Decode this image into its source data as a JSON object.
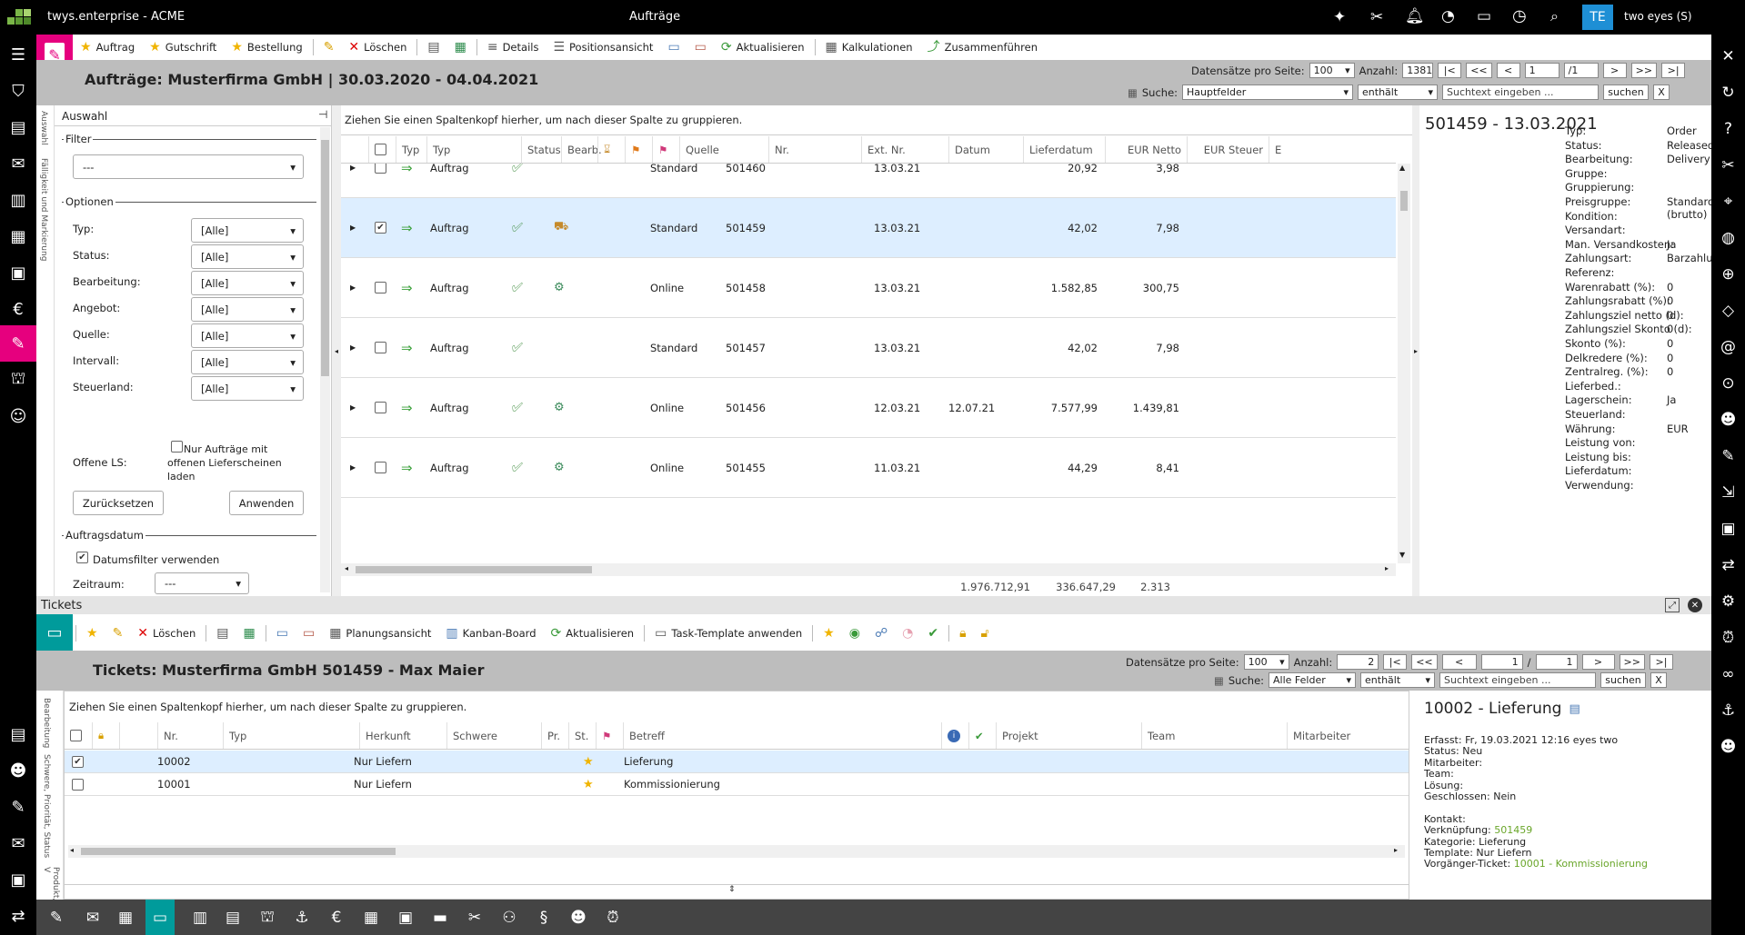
{
  "app": {
    "title": "twys.enterprise - ACME",
    "window_title": "Aufträge",
    "user_initials": "TE",
    "user_name": "two eyes (S)"
  },
  "orders": {
    "toolbar": {
      "auftrag": "Auftrag",
      "gutschrift": "Gutschrift",
      "bestellung": "Bestellung",
      "loeschen": "Löschen",
      "details": "Details",
      "positionsansicht": "Positionsansicht",
      "aktualisieren": "Aktualisieren",
      "kalkulationen": "Kalkulationen",
      "zusammenfuehren": "Zusammenführen"
    },
    "title": "Aufträge: Musterfirma GmbH | 30.03.2020 - 04.04.2021",
    "pager": {
      "label": "Datensätze pro Seite:",
      "per_page": "100",
      "count_label": "Anzahl:",
      "count": "1381",
      "first": "|<",
      "prev2": "<<",
      "prev": "<",
      "page": "1",
      "of": "/1",
      "next": ">",
      "next2": ">>",
      "last": ">|"
    },
    "search": {
      "label": "Suche:",
      "field": "Hauptfelder",
      "op": "enthält",
      "placeholder": "Suchtext eingeben ...",
      "button": "suchen",
      "clear": "X"
    },
    "filter_panel": {
      "header": "Auswahl",
      "pin": "⊣",
      "side_tabs": [
        "Auswahl",
        "Fälligkeit und Markierung"
      ],
      "filter_legend": "Filter",
      "filter_value": "---",
      "options_legend": "Optionen",
      "options": [
        {
          "label": "Typ:",
          "value": "[Alle]"
        },
        {
          "label": "Status:",
          "value": "[Alle]"
        },
        {
          "label": "Bearbeitung:",
          "value": "[Alle]"
        },
        {
          "label": "Angebot:",
          "value": "[Alle]"
        },
        {
          "label": "Quelle:",
          "value": "[Alle]"
        },
        {
          "label": "Intervall:",
          "value": "[Alle]"
        },
        {
          "label": "Steuerland:",
          "value": "[Alle]"
        }
      ],
      "offene_ls_label": "Offene LS:",
      "offene_ls_text": "Nur Aufträge mit offenen Lieferscheinen laden",
      "reset": "Zurücksetzen",
      "apply": "Anwenden",
      "date_legend": "Auftragsdatum",
      "date_filter": "Datumsfilter verwenden",
      "zeitraum_label": "Zeitraum:",
      "zeitraum_value": "---"
    },
    "group_hint": "Ziehen Sie einen Spaltenkopf hierher, um nach dieser Spalte zu gruppieren.",
    "columns": [
      "Typ",
      "Typ",
      "Status",
      "Bearb.",
      "Quelle",
      "Nr.",
      "Ext. Nr.",
      "Datum",
      "Lieferdatum",
      "EUR Netto",
      "EUR Steuer",
      "E"
    ],
    "rows": [
      {
        "type": "Auftrag",
        "source": "Standard",
        "nr": "501460",
        "date": "13.03.21",
        "delivery": "",
        "net": "20,92",
        "tax": "3,98",
        "checked": false,
        "bearb": ""
      },
      {
        "type": "Auftrag",
        "source": "Standard",
        "nr": "501459",
        "date": "13.03.21",
        "delivery": "",
        "net": "42,02",
        "tax": "7,98",
        "checked": true,
        "bearb": "truck"
      },
      {
        "type": "Auftrag",
        "source": "Online",
        "nr": "501458",
        "date": "13.03.21",
        "delivery": "",
        "net": "1.582,85",
        "tax": "300,75",
        "checked": false,
        "bearb": "gear"
      },
      {
        "type": "Auftrag",
        "source": "Standard",
        "nr": "501457",
        "date": "13.03.21",
        "delivery": "",
        "net": "42,02",
        "tax": "7,98",
        "checked": false,
        "bearb": ""
      },
      {
        "type": "Auftrag",
        "source": "Online",
        "nr": "501456",
        "date": "12.03.21",
        "delivery": "12.07.21",
        "net": "7.577,99",
        "tax": "1.439,81",
        "checked": false,
        "bearb": "gear"
      },
      {
        "type": "Auftrag",
        "source": "Online",
        "nr": "501455",
        "date": "11.03.21",
        "delivery": "",
        "net": "44,29",
        "tax": "8,41",
        "checked": false,
        "bearb": "gear"
      }
    ],
    "totals": {
      "net": "1.976.712,91",
      "tax": "336.647,29",
      "other": "2.313"
    },
    "detail": {
      "title": "501459 - 13.03.2021",
      "fields": [
        {
          "label": "Typ:",
          "value": "Order"
        },
        {
          "label": "Status:",
          "value": "Released"
        },
        {
          "label": "Bearbeitung:",
          "value": "Delivery"
        },
        {
          "label": "Gruppe:",
          "value": ""
        },
        {
          "label": "Gruppierung:",
          "value": ""
        },
        {
          "label": "Preisgruppe:",
          "value": "Standard (brutto)"
        },
        {
          "label": "Kondition:",
          "value": ""
        },
        {
          "label": "Versandart:",
          "value": ""
        },
        {
          "label": "Man. Versandkosten:",
          "value": "Ja"
        },
        {
          "label": "Zahlungsart:",
          "value": "Barzahlung"
        },
        {
          "label": "Referenz:",
          "value": ""
        },
        {
          "label": "Warenrabatt (%):",
          "value": "0"
        },
        {
          "label": "Zahlungsrabatt (%):",
          "value": "0"
        },
        {
          "label": "Zahlungsziel netto (d):",
          "value": "0"
        },
        {
          "label": "Zahlungsziel Skonto (d):",
          "value": "0"
        },
        {
          "label": "Skonto (%):",
          "value": "0"
        },
        {
          "label": "Delkredere (%):",
          "value": "0"
        },
        {
          "label": "Zentralreg. (%):",
          "value": "0"
        },
        {
          "label": "Lieferbed.:",
          "value": ""
        },
        {
          "label": "Lagerschein:",
          "value": "Ja"
        },
        {
          "label": "Steuerland:",
          "value": ""
        },
        {
          "label": "Währung:",
          "value": "EUR"
        },
        {
          "label": "Leistung von:",
          "value": ""
        },
        {
          "label": "Leistung bis:",
          "value": ""
        },
        {
          "label": "Lieferdatum:",
          "value": ""
        },
        {
          "label": "Verwendung:",
          "value": ""
        }
      ]
    }
  },
  "tickets": {
    "header": "Tickets",
    "toolbar": {
      "loeschen": "Löschen",
      "planungsansicht": "Planungsansicht",
      "kanban": "Kanban-Board",
      "aktualisieren": "Aktualisieren",
      "task_template": "Task-Template anwenden"
    },
    "title": "Tickets: Musterfirma GmbH 501459 - Max Maier",
    "pager": {
      "label": "Datensätze pro Seite:",
      "per_page": "100",
      "count_label": "Anzahl:",
      "count": "2",
      "first": "|<",
      "prev2": "<<",
      "prev": "<",
      "page": "1",
      "of": "/",
      "total": "1",
      "next": ">",
      "next2": ">>",
      "last": ">|"
    },
    "search": {
      "label": "Suche:",
      "field": "Alle Felder",
      "op": "enthält",
      "placeholder": "Suchtext eingeben ...",
      "button": "suchen",
      "clear": "X"
    },
    "side_tabs": [
      "Bearbeitung",
      "Schwere, Priorität, Status",
      "Produkt, V"
    ],
    "group_hint": "Ziehen Sie einen Spaltenkopf hierher, um nach dieser Spalte zu gruppieren.",
    "columns": [
      "Nr.",
      "Typ",
      "Herkunft",
      "Schwere",
      "Pr.",
      "St.",
      "Betreff",
      "Projekt",
      "Team",
      "Mitarbeiter"
    ],
    "rows": [
      {
        "nr": "10002",
        "herkunft": "Nur Liefern",
        "betreff": "Lieferung",
        "checked": true
      },
      {
        "nr": "10001",
        "herkunft": "Nur Liefern",
        "betreff": "Kommissionierung",
        "checked": false
      }
    ],
    "detail": {
      "title": "10002 - Lieferung",
      "lines": [
        {
          "label": "Erfasst:",
          "value": "Fr, 19.03.2021 12:16 eyes two",
          "link": false
        },
        {
          "label": "Status:",
          "value": "Neu",
          "link": false
        },
        {
          "label": "Mitarbeiter:",
          "value": "",
          "link": false
        },
        {
          "label": "Team:",
          "value": "",
          "link": false
        },
        {
          "label": "Lösung:",
          "value": "",
          "link": false
        },
        {
          "label": "Geschlossen:",
          "value": "Nein",
          "link": false
        },
        {
          "label": "",
          "value": "",
          "link": false
        },
        {
          "label": "Kontakt:",
          "value": "",
          "link": false
        },
        {
          "label": "Verknüpfung:",
          "value": "501459",
          "link": true
        },
        {
          "label": "Kategorie:",
          "value": "Lieferung",
          "link": false
        },
        {
          "label": "Template:",
          "value": "Nur Liefern",
          "link": false
        },
        {
          "label": "Vorgänger-Ticket:",
          "value": "10001 - Kommissionierung",
          "link": true
        }
      ]
    }
  },
  "colors": {
    "accent_magenta": "#e6007e",
    "accent_teal": "#009b9b",
    "link_green": "#6aa62a",
    "selected_row": "#ddeeff"
  }
}
